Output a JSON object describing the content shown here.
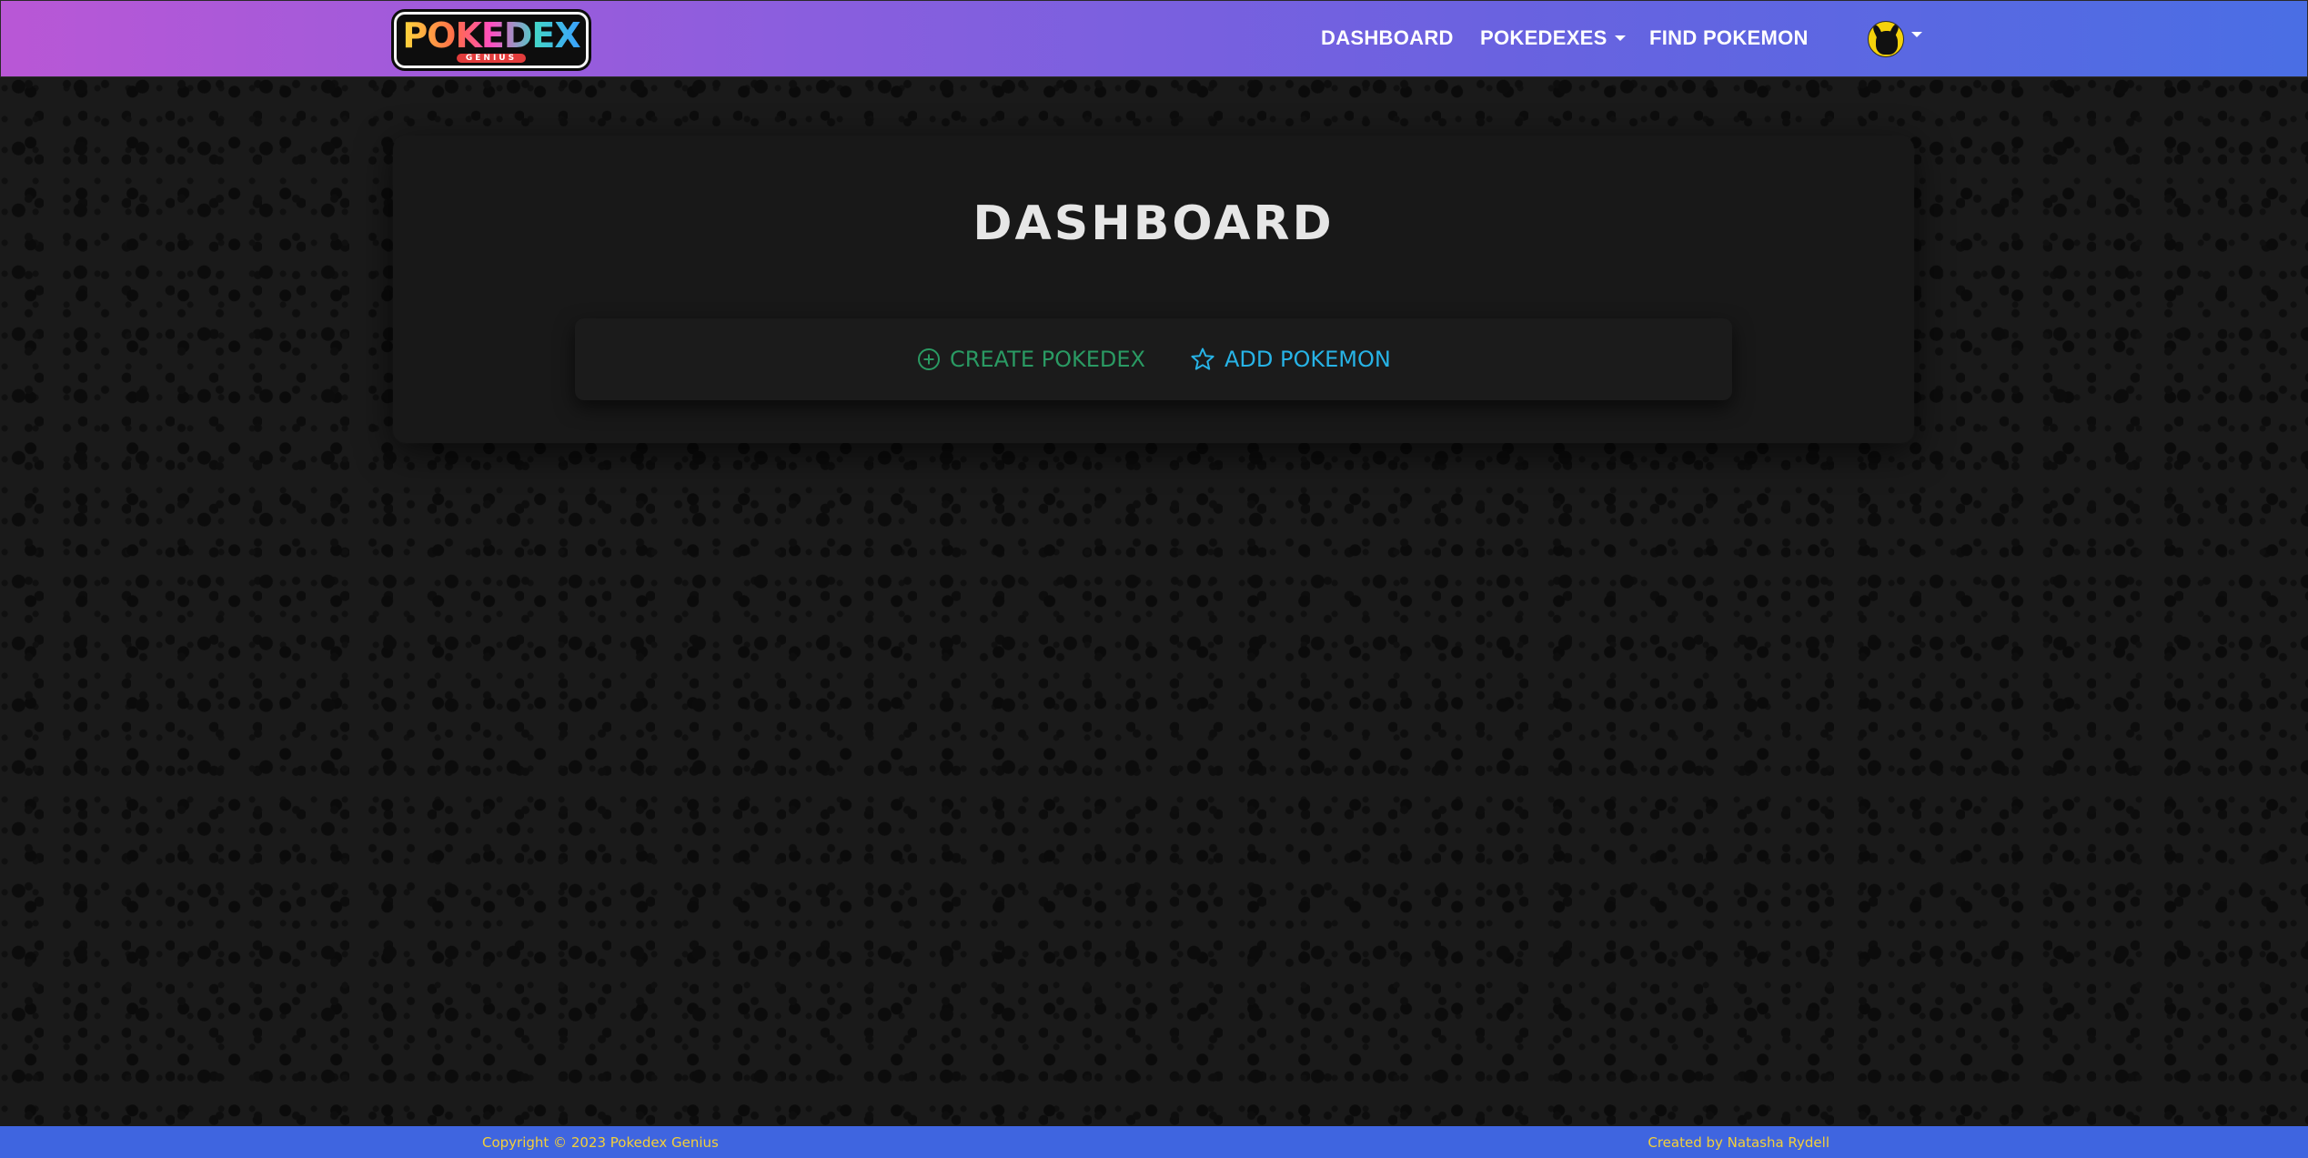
{
  "navbar": {
    "brand_word": "POKEDEX",
    "brand_sub": "GENIUS",
    "links": {
      "dashboard": "DASHBOARD",
      "pokedexes": "POKEDEXES",
      "find": "FIND POKEMON"
    }
  },
  "main": {
    "title": "DASHBOARD",
    "actions": {
      "create": "CREATE POKEDEX",
      "add": "ADD POKEMON"
    }
  },
  "footer": {
    "copyright": "Copyright © 2023 Pokedex Genius",
    "credit": "Created by Natasha Rydell"
  },
  "colors": {
    "create_accent": "#2a9a63",
    "add_accent": "#27b3e6",
    "footer_bg": "#3f65e0",
    "footer_text": "#f3cf3a"
  },
  "icons": {
    "create": "plus-circle-icon",
    "add": "star-icon",
    "avatar": "pikachu-silhouette-avatar"
  }
}
